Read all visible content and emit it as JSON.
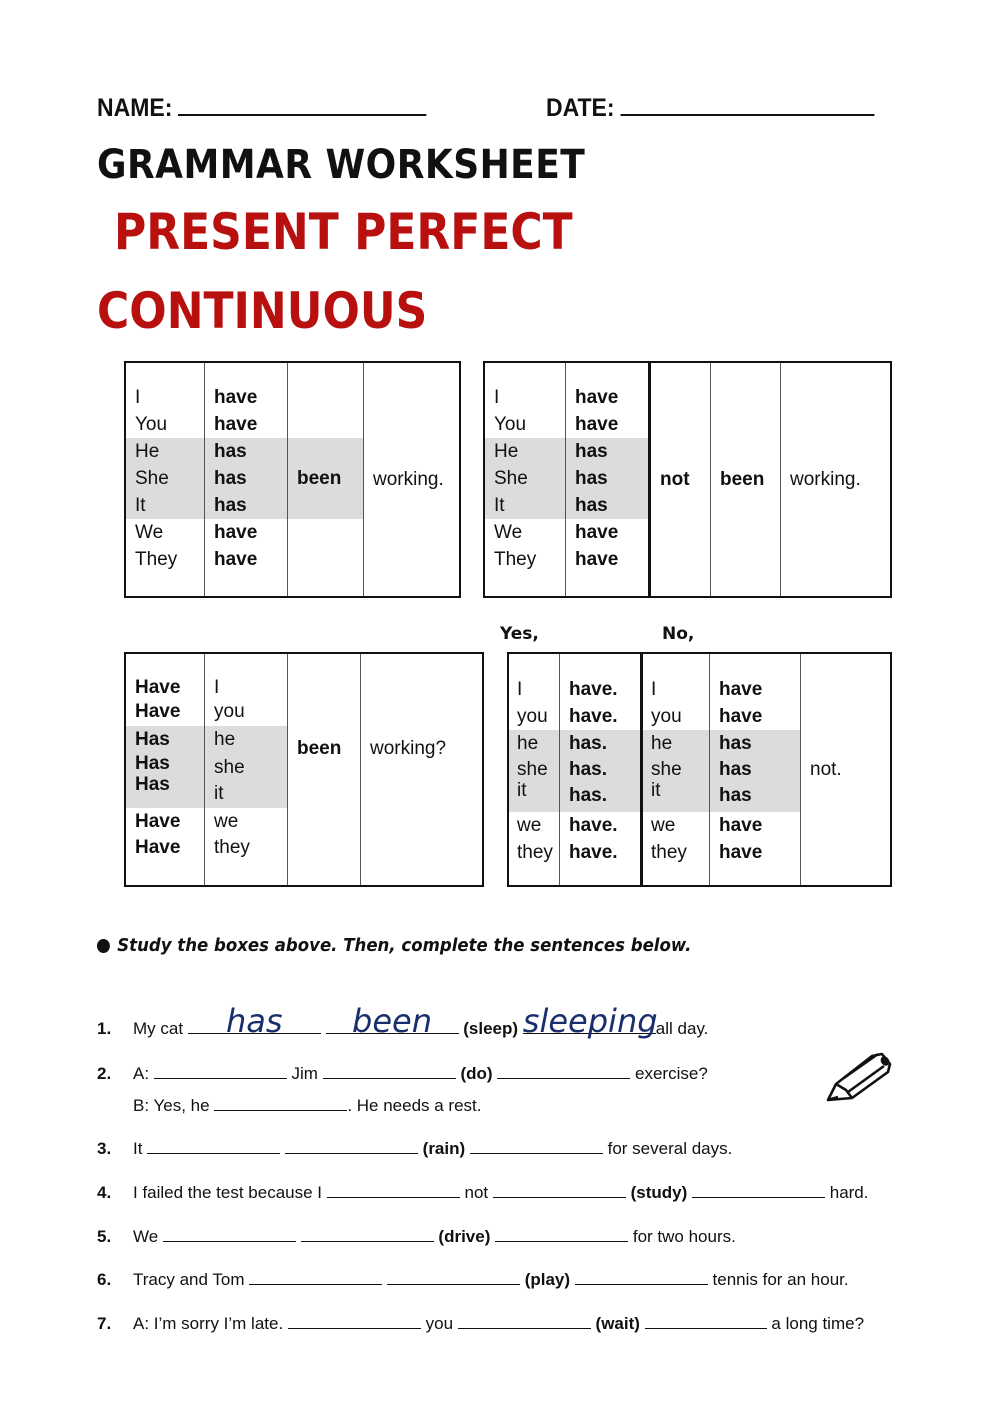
{
  "header": {
    "name_label": "NAME:",
    "date_label": "DATE:"
  },
  "title": {
    "line1": "GRAMMAR WORKSHEET",
    "line2": "PRESENT PERFECT",
    "line3": "CONTINUOUS",
    "accent_color": "#b80f0f"
  },
  "affirmative": {
    "subjects": [
      "I",
      "You",
      "He",
      "She",
      "It",
      "We",
      "They"
    ],
    "auxiliaries": [
      "have",
      "have",
      "has",
      "has",
      "has",
      "have",
      "have"
    ],
    "been": "been",
    "verb": "working."
  },
  "negative": {
    "subjects": [
      "I",
      "You",
      "He",
      "She",
      "It",
      "We",
      "They"
    ],
    "auxiliaries": [
      "have",
      "have",
      "has",
      "has",
      "has",
      "have",
      "have"
    ],
    "not": "not",
    "been": "been",
    "verb": "working."
  },
  "question": {
    "auxiliaries": [
      "Have",
      "Have",
      "Has",
      "Has",
      "Has",
      "Have",
      "Have"
    ],
    "subjects": [
      "I",
      "you",
      "he",
      "she",
      "it",
      "we",
      "they"
    ],
    "been": "been",
    "verb": "working?"
  },
  "short_answers": {
    "yes_label": "Yes,",
    "no_label": "No,",
    "yes_subjects": [
      "I",
      "you",
      "he",
      "she",
      "it",
      "we",
      "they"
    ],
    "yes_auxiliaries": [
      "have.",
      "have.",
      "has.",
      "has.",
      "has.",
      "have.",
      "have."
    ],
    "no_subjects": [
      "I",
      "you",
      "he",
      "she",
      "it",
      "we",
      "they"
    ],
    "no_auxiliaries": [
      "have",
      "have",
      "has",
      "has",
      "has",
      "have",
      "have"
    ],
    "no_tail": "not."
  },
  "instructions": "Study the boxes above.  Then, complete the sentences below.",
  "exercises": [
    {
      "num": "1.",
      "p1": "My cat",
      "a1": "has",
      "a2": "been",
      "verb": "(sleep)",
      "a3": "sleeping",
      "p2": "all day.",
      "answer_color": "#1a2e6e"
    },
    {
      "num": "2.",
      "p1": "A:",
      "p2": "Jim",
      "verb": "(do)",
      "p3": "exercise?",
      "line2_a": "B: Yes, he",
      "line2_b": ".  He needs a rest."
    },
    {
      "num": "3.",
      "p1": "It",
      "verb": "(rain)",
      "p2": "for several days."
    },
    {
      "num": "4.",
      "p1": "I failed the test because I",
      "p2": "not",
      "verb": "(study)",
      "p3": "hard."
    },
    {
      "num": "5.",
      "p1": "We",
      "verb": "(drive)",
      "p2": "for two hours."
    },
    {
      "num": "6.",
      "p1": "Tracy and Tom",
      "verb": "(play)",
      "p2": "tennis for an hour."
    },
    {
      "num": "7.",
      "p1": "A: I’m sorry I’m late.",
      "p2": "you",
      "verb": "(wait)",
      "p3": "a long time?"
    }
  ],
  "icons": {
    "pencil": "pencil-icon"
  }
}
